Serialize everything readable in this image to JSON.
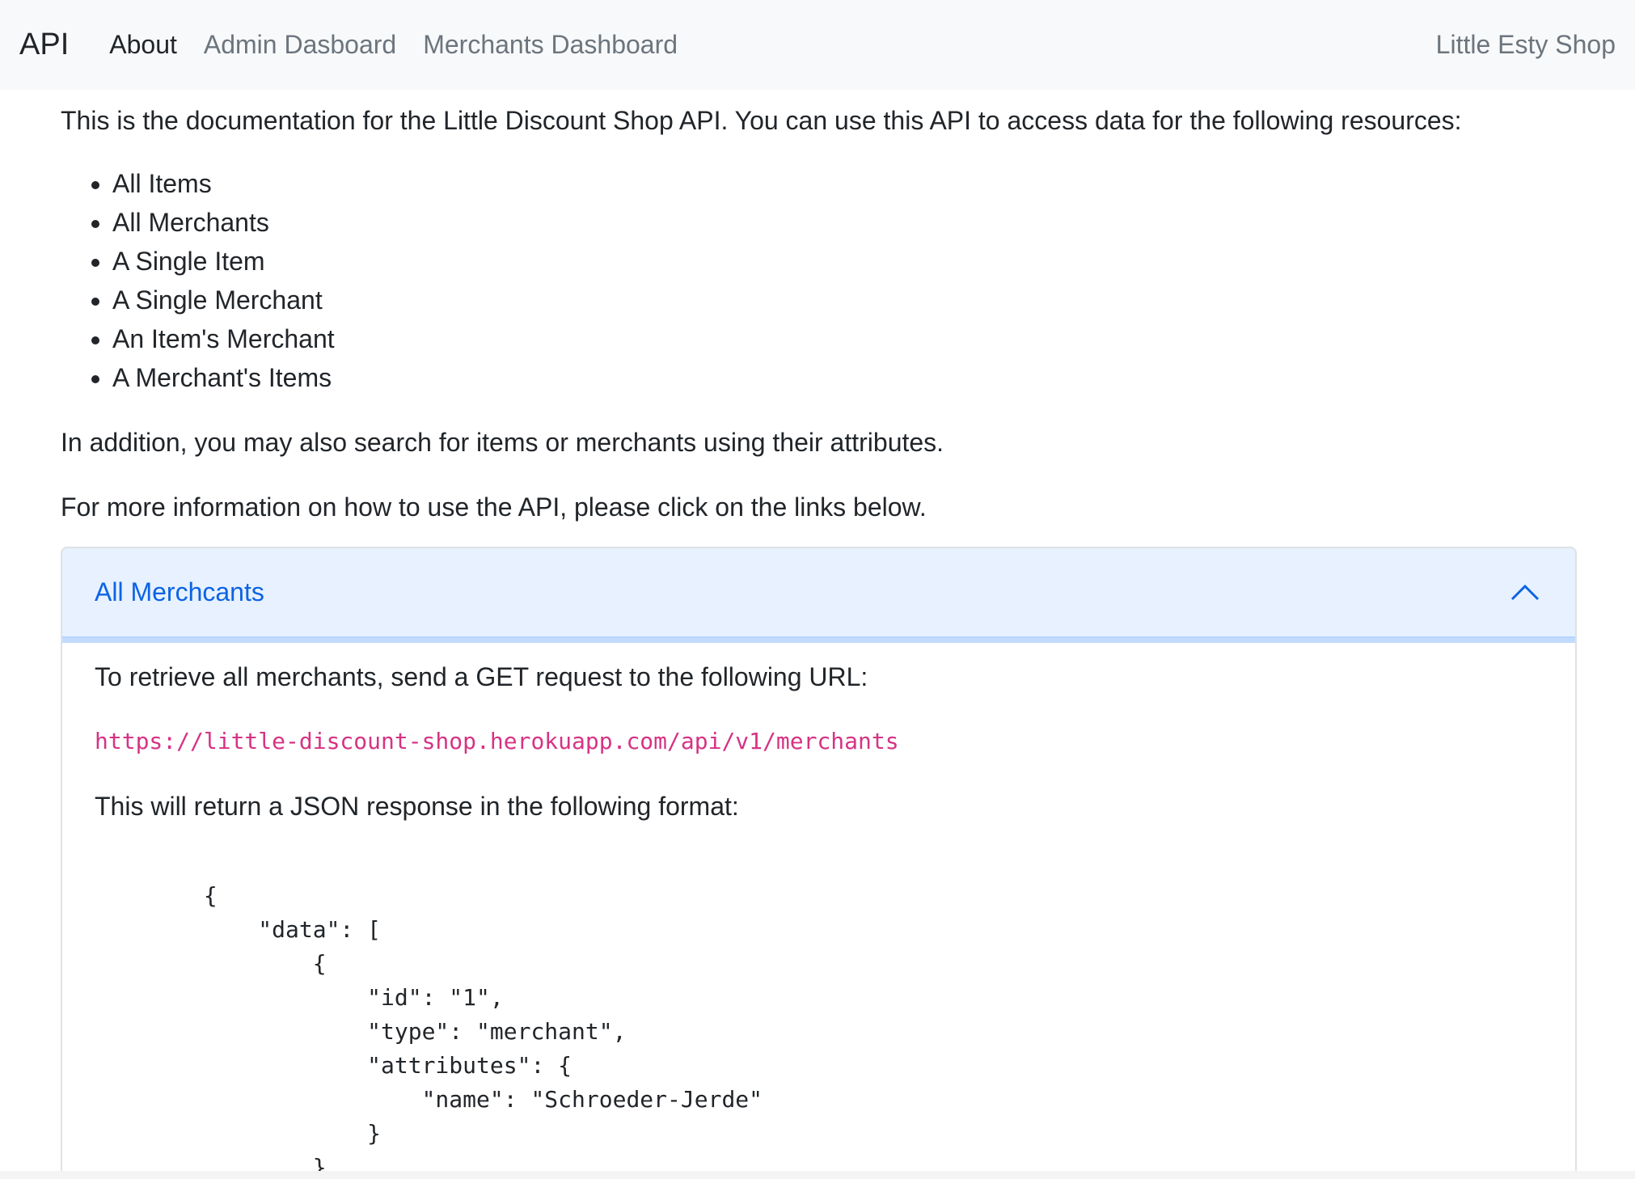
{
  "navbar": {
    "brand": "API",
    "links": [
      "About",
      "Admin Dasboard",
      "Merchants Dashboard"
    ],
    "right_link": "Little Esty Shop"
  },
  "main": {
    "intro": "This is the documentation for the Little Discount Shop API. You can use this API to access data for the following resources:",
    "resources": [
      "All Items",
      "All Merchants",
      "A Single Item",
      "A Single Merchant",
      "An Item's Merchant",
      "A Merchant's Items"
    ],
    "search_note": "In addition, you may also search for items or merchants using their attributes.",
    "more_info": "For more information on how to use the API, please click on the links below."
  },
  "accordion": {
    "header": "All Merchcants",
    "icon": "chevron-up-icon",
    "body_text": "To retrieve all merchants, send a GET request to the following URL:",
    "url": "https://little-discount-shop.herokuapp.com/api/v1/merchants",
    "response_text": "This will return a JSON response in the following format:",
    "code": "        {\n            \"data\": [\n                {\n                    \"id\": \"1\",\n                    \"type\": \"merchant\",\n                    \"attributes\": {\n                        \"name\": \"Schroeder-Jerde\"\n                    }\n                },"
  },
  "colors": {
    "navbar_bg": "#f8f9fa",
    "accordion_active_bg": "#e7f1ff",
    "accordion_active_text": "#0c63e4",
    "code_inline": "#d63384"
  }
}
